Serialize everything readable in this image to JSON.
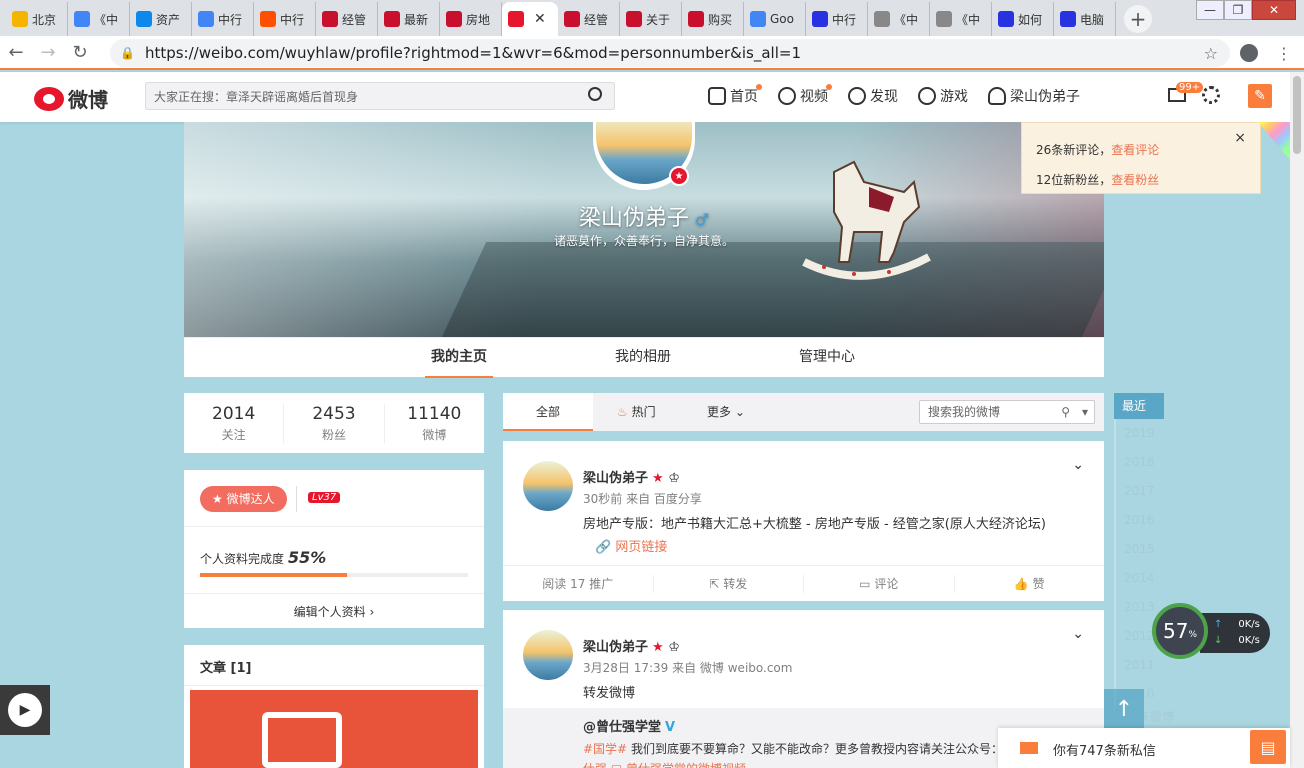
{
  "browser": {
    "tabs": [
      {
        "label": "北京",
        "icon": "shield-icon",
        "color": "#f4b400"
      },
      {
        "label": "《中",
        "icon": "google-icon",
        "color": "#4285f4"
      },
      {
        "label": "资产",
        "icon": "zhihu-icon",
        "color": "#0f88eb"
      },
      {
        "label": "中行",
        "icon": "google-icon",
        "color": "#4285f4"
      },
      {
        "label": "中行",
        "icon": "taobao-icon",
        "color": "#ff5000"
      },
      {
        "label": "经管",
        "icon": "e-icon",
        "color": "#c8102e"
      },
      {
        "label": "最新",
        "icon": "e-icon",
        "color": "#c8102e"
      },
      {
        "label": "房地",
        "icon": "e-icon",
        "color": "#c8102e"
      },
      {
        "label": "",
        "icon": "weibo-icon",
        "color": "#e6162d",
        "active": true
      },
      {
        "label": "经管",
        "icon": "e-icon",
        "color": "#c8102e"
      },
      {
        "label": "关于",
        "icon": "e-icon",
        "color": "#c8102e"
      },
      {
        "label": "购买",
        "icon": "e-icon",
        "color": "#c8102e"
      },
      {
        "label": "Goo",
        "icon": "translate-icon",
        "color": "#4285f4"
      },
      {
        "label": "中行",
        "icon": "baidu-icon",
        "color": "#2932e1"
      },
      {
        "label": "《中",
        "icon": "doc-icon",
        "color": "#888888"
      },
      {
        "label": "《中",
        "icon": "doc-icon",
        "color": "#888888"
      },
      {
        "label": "如何",
        "icon": "baidu-icon",
        "color": "#2932e1"
      },
      {
        "label": "电脑",
        "icon": "baidu-icon",
        "color": "#2932e1"
      }
    ],
    "url": "https://weibo.com/wuyhlaw/profile?rightmod=1&wvr=6&mod=personnumber&is_all=1"
  },
  "header": {
    "logo": "微博",
    "search_placeholder": "大家正在搜：章泽天辟谣离婚后首现身",
    "nav": [
      "首页",
      "视频",
      "发现",
      "游戏",
      "梁山伪弟子"
    ],
    "mail_badge": "99+"
  },
  "notify": {
    "line1_prefix": "26条新评论，",
    "line1_link": "查看评论",
    "line2_prefix": "12位新粉丝，",
    "line2_link": "查看粉丝"
  },
  "profile": {
    "name": "梁山伪弟子",
    "gender_symbol": "♂",
    "signature": "诸恶莫作，众善奉行，自净其意。",
    "tabs": [
      "我的主页",
      "我的相册",
      "管理中心"
    ]
  },
  "stats": [
    {
      "num": "2014",
      "label": "关注"
    },
    {
      "num": "2453",
      "label": "粉丝"
    },
    {
      "num": "11140",
      "label": "微博"
    }
  ],
  "rank": {
    "daren": "微博达人",
    "level": "Lv37",
    "completion_label": "个人资料完成度",
    "completion_value": "55%",
    "completion_fraction": 0.55,
    "edit": "编辑个人资料"
  },
  "article": {
    "title": "文章 [1]"
  },
  "feed": {
    "tabs": [
      "全部",
      "热门",
      "更多"
    ],
    "search_placeholder": "搜索我的微博"
  },
  "posts": [
    {
      "name": "梁山伪弟子",
      "time": "30秒前 来自 百度分享",
      "text": "房地产专版：地产书籍大汇总+大梳整 - 房地产专版 - 经管之家(原人大经济论坛)",
      "link": "网页链接",
      "actions": [
        "阅读 17   推广",
        "转发",
        "评论",
        "赞"
      ]
    },
    {
      "name": "梁山伪弟子",
      "time": "3月28日 17:39 来自 微博 weibo.com",
      "text": "转发微博",
      "rt_name": "@曾仕强学堂",
      "rt_tag": "#国学#",
      "rt_text": " 我们到底要不要算命？又能不能改命？更多曾教授内容请关注公众号：曾",
      "rt_src": "仕强  □ 曾仕强学堂的微博视频"
    }
  ],
  "timeline": {
    "recent": "最近",
    "years": [
      "2019",
      "2018",
      "2017",
      "2016",
      "2015",
      "2014",
      "2013",
      "2012",
      "2011",
      "2010"
    ],
    "last": "一条微博"
  },
  "netwidget": {
    "percent": "57",
    "unit": "%",
    "up": "0K/s",
    "down": "0K/s"
  },
  "msgbar": {
    "text": "你有747条新私信"
  }
}
